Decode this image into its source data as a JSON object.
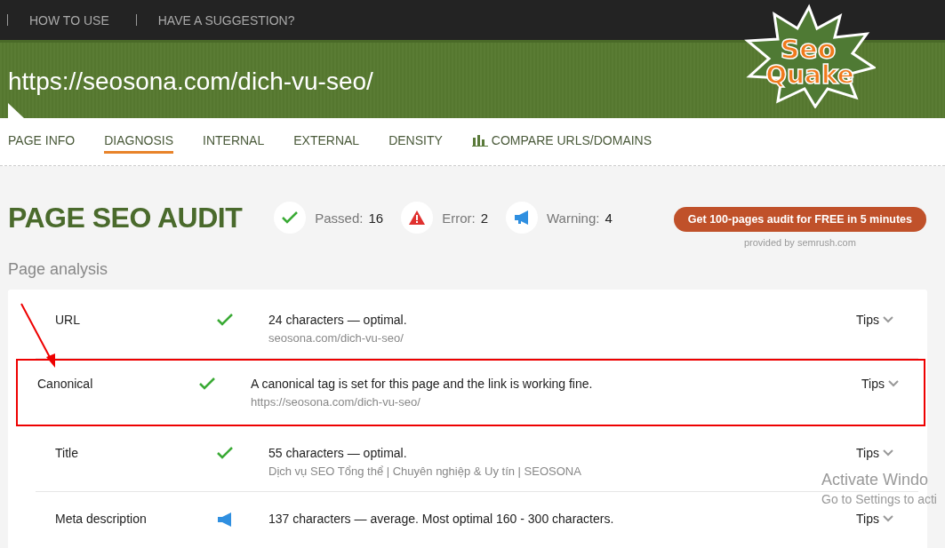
{
  "top_links": [
    "HOW TO USE",
    "HAVE A SUGGESTION?"
  ],
  "logo": {
    "line_1": "Seo",
    "line_2": "Quake"
  },
  "page_url": "https://seosona.com/dich-vu-seo/",
  "tabs": [
    {
      "label": "PAGE INFO",
      "selected": false,
      "icon": false
    },
    {
      "label": "DIAGNOSIS",
      "selected": true,
      "icon": false
    },
    {
      "label": "INTERNAL",
      "selected": false,
      "icon": false
    },
    {
      "label": "EXTERNAL",
      "selected": false,
      "icon": false
    },
    {
      "label": "DENSITY",
      "selected": false,
      "icon": false
    },
    {
      "label": "COMPARE URLS/DOMAINS",
      "selected": false,
      "icon": true
    }
  ],
  "heading": "PAGE SEO AUDIT",
  "summary": [
    {
      "kind": "passed",
      "label": "Passed:",
      "count": "16"
    },
    {
      "kind": "error",
      "label": "Error:",
      "count": "2"
    },
    {
      "kind": "warning",
      "label": "Warning:",
      "count": "4"
    }
  ],
  "promo": {
    "button": "Get 100-pages audit for FREE in 5 minutes",
    "provided_by": "provided by",
    "provider": "semrush.com"
  },
  "section_title": "Page analysis",
  "rows": [
    {
      "name": "URL",
      "kind": "passed",
      "message": "24 characters — optimal.",
      "detail": "seosona.com/dich-vu-seo/",
      "tips": "Tips",
      "highlighted": false
    },
    {
      "name": "Canonical",
      "kind": "passed",
      "message": "A canonical tag is set for this page and the link is working fine.",
      "detail": "https://seosona.com/dich-vu-seo/",
      "tips": "Tips",
      "highlighted": true
    },
    {
      "name": "Title",
      "kind": "passed",
      "message": "55 characters — optimal.",
      "detail": "Dịch vụ SEO Tổng thể | Chuyên nghiệp & Uy tín | SEOSONA",
      "tips": "Tips",
      "highlighted": false
    },
    {
      "name": "Meta description",
      "kind": "warning",
      "message": "137 characters — average. Most optimal 160 - 300 characters.",
      "detail": "",
      "tips": "Tips",
      "highlighted": false
    }
  ],
  "system_overlay": {
    "line_1": "Activate Windo",
    "line_2": "Go to Settings to acti"
  }
}
